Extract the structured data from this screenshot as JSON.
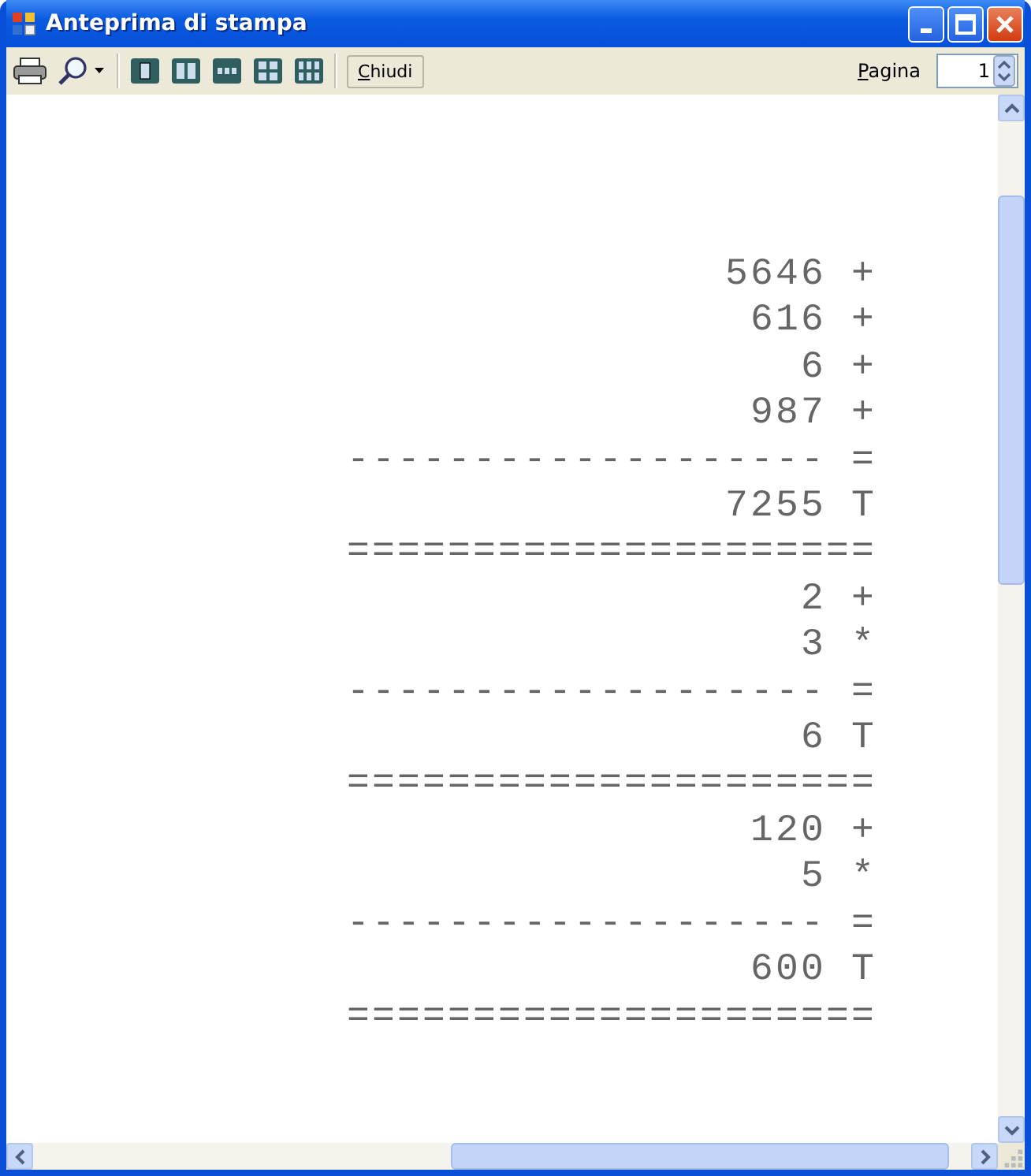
{
  "window": {
    "title": "Anteprima di stampa"
  },
  "toolbar": {
    "close_button": "Chiudi",
    "page_label": "Pagina",
    "page_value": "1"
  },
  "page": {
    "lines": [
      "5646 +",
      "616 +",
      "6 +",
      "987 +",
      "------------------- =",
      "7255 T",
      "=====================",
      "2 +",
      "3 *",
      "------------------- =",
      "6 T",
      "=====================",
      "120 +",
      "5 *",
      "------------------- =",
      "600 T",
      "====================="
    ]
  }
}
